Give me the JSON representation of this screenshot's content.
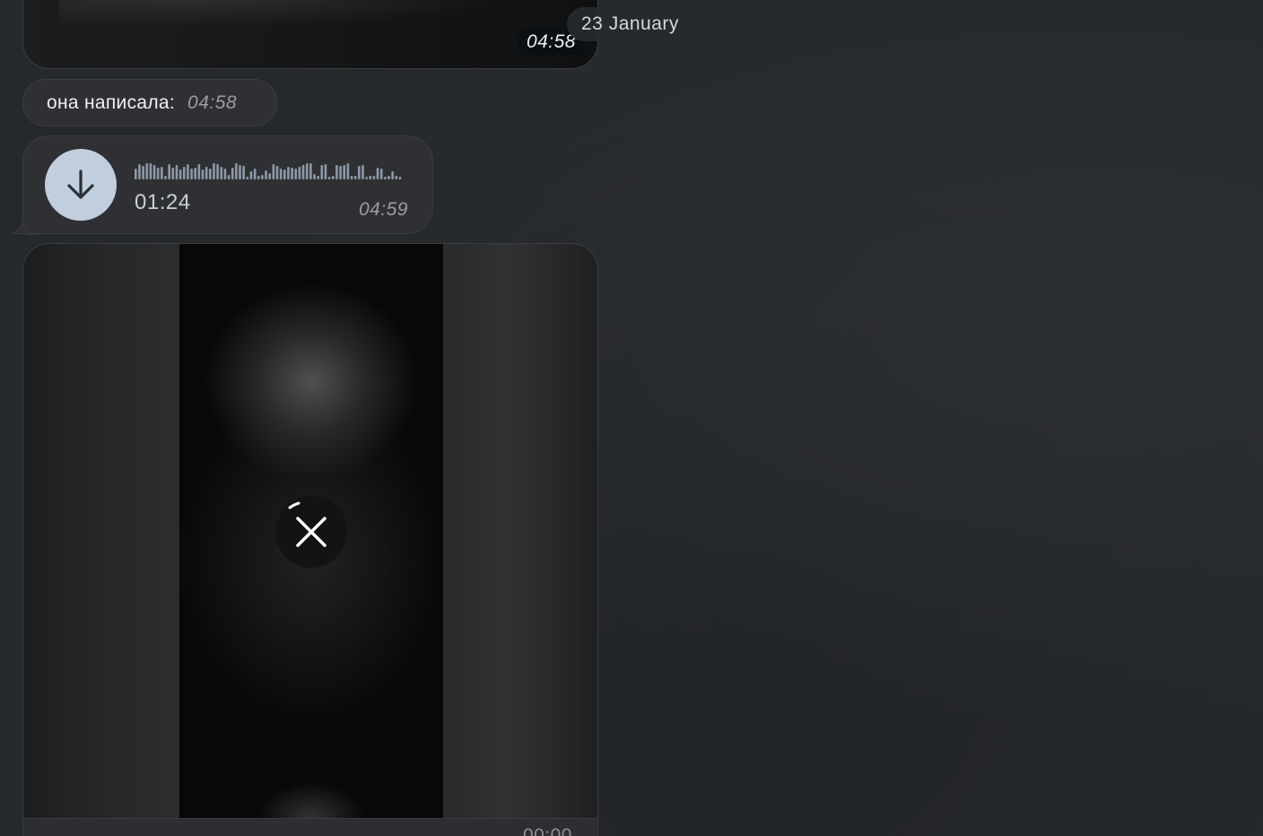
{
  "date_separator": {
    "label": "23 January"
  },
  "messages": [
    {
      "type": "media",
      "time": "04:58"
    },
    {
      "type": "text",
      "text": "она написала:",
      "time": "04:58"
    },
    {
      "type": "voice",
      "duration": "01:24",
      "time": "04:59",
      "download_icon": "arrow-down-icon"
    },
    {
      "type": "video",
      "time": "00:00",
      "cancel_icon": "close-icon"
    }
  ],
  "colors": {
    "background": "#26292c",
    "bubble": "#2f3033",
    "download_button": "#c1cede",
    "waveform": "#8d99a8"
  }
}
